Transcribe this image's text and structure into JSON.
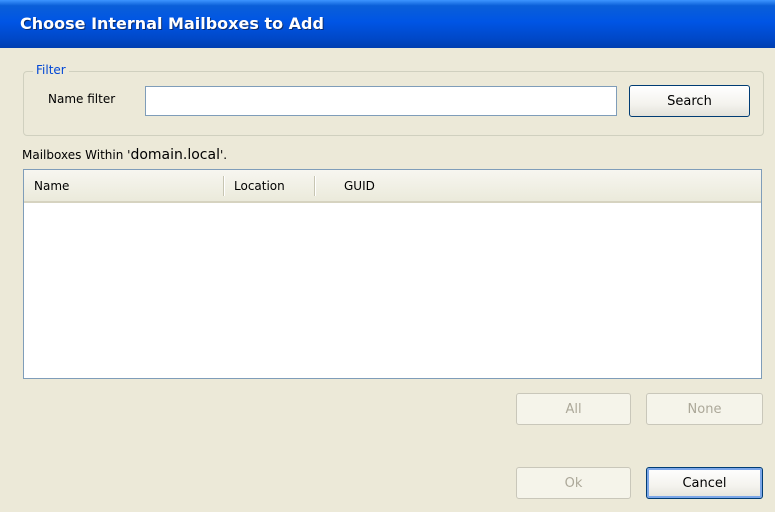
{
  "window": {
    "title": "Choose Internal Mailboxes to Add"
  },
  "filter": {
    "group_label": "Filter",
    "name_filter_label": "Name filter",
    "name_filter_value": "",
    "search_button": "Search"
  },
  "mailboxes": {
    "heading_prefix": "Mailboxes Within '",
    "domain": "domain.local",
    "heading_suffix": "'.",
    "columns": [
      "Name",
      "Location",
      "GUID"
    ],
    "rows": []
  },
  "selection_buttons": {
    "all": "All",
    "none": "None"
  },
  "dialog_buttons": {
    "ok": "Ok",
    "cancel": "Cancel"
  },
  "colors": {
    "titlebar": "#0055e5",
    "dialog_background": "#ece9d8",
    "legend_text": "#0046d5"
  }
}
